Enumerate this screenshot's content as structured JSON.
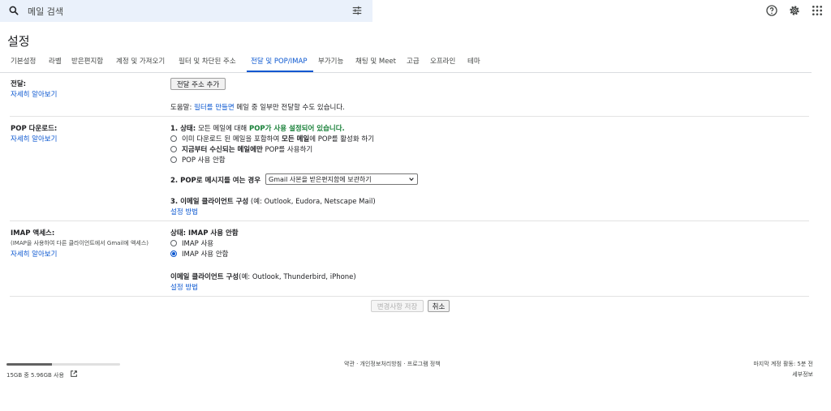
{
  "search": {
    "placeholder": "메일 검색"
  },
  "page": {
    "title": "설정"
  },
  "tabs": [
    {
      "label": "기본설정"
    },
    {
      "label": "라벨"
    },
    {
      "label": "받은편지함"
    },
    {
      "label": "계정 및 가져오기"
    },
    {
      "label": "필터 및 차단된 주소"
    },
    {
      "label": "전달 및 POP/IMAP",
      "active": true
    },
    {
      "label": "부가기능"
    },
    {
      "label": "채팅 및 Meet"
    },
    {
      "label": "고급"
    },
    {
      "label": "오프라인"
    },
    {
      "label": "테마"
    }
  ],
  "forwarding": {
    "label": "전달:",
    "learn_more": "자세히 알아보기",
    "add_button": "전달 주소 추가",
    "tip_prefix": "도움말: ",
    "tip_link": "필터를 만들면",
    "tip_suffix": " 메일 중 일부만 전달할 수도 있습니다."
  },
  "pop": {
    "label": "POP 다운로드:",
    "learn_more": "자세히 알아보기",
    "status_prefix": "1. 상태: ",
    "status_middle": "모든 메일에 대해 ",
    "status_enabled": "POP가 사용 설정되어 있습니다.",
    "option1_a": "이미 다운로드 된 메일을 포함하여 ",
    "option1_b": "모든 메일",
    "option1_c": "에 POP를 활성화 하기",
    "option2_a": "지금부터 수신되는 메일에만",
    "option2_b": " POP를 사용하기",
    "option3": "POP 사용 안함",
    "step2_label": "2. POP로 메시지를 여는 경우",
    "step2_select": "Gmail 사본을 받은편지함에 보관하기",
    "step3_label": "3. 이메일 클라이언트 구성",
    "step3_example": " (예: Outlook, Eudora, Netscape Mail)",
    "setup_link": "설정 방법"
  },
  "imap": {
    "label": "IMAP 액세스:",
    "subtext": "(IMAP을 사용하여 다른 클라이언트에서 Gmail에 액세스)",
    "learn_more": "자세히 알아보기",
    "status": "상태: IMAP 사용 안함",
    "option_enable": "IMAP 사용",
    "option_disable": "IMAP 사용 안함",
    "client_label": "이메일 클라이언트 구성",
    "client_example": "(예: Outlook, Thunderbird, iPhone)",
    "setup_link": "설정 방법"
  },
  "actions": {
    "save": "변경사항 저장",
    "cancel": "취소"
  },
  "footer": {
    "storage_text": "15GB 중 5.96GB 사용",
    "storage_fraction": 0.397,
    "terms": "약관 · 개인정보처리방침 · 프로그램 정책",
    "last_activity": "마지막 계정 활동: 5분 전",
    "details": "세부정보"
  },
  "colors": {
    "accent": "#0b57d0",
    "search_bg": "#eaf1fb",
    "enabled_green": "#188038"
  },
  "icons": [
    "search-icon",
    "filter-options-icon",
    "help-icon",
    "settings-icon",
    "apps-grid-icon",
    "external-link-icon"
  ]
}
